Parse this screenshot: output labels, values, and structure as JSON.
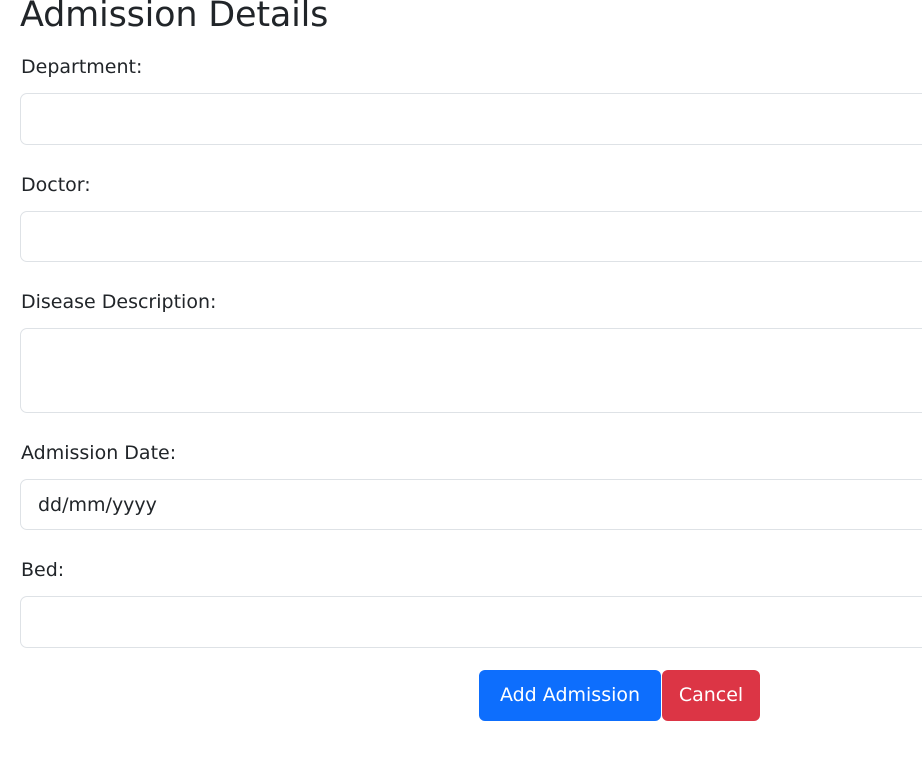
{
  "page": {
    "title": "Admission Details"
  },
  "form": {
    "department": {
      "label": "Department:",
      "value": "",
      "placeholder": ""
    },
    "doctor": {
      "label": "Doctor:",
      "value": "",
      "placeholder": ""
    },
    "disease_description": {
      "label": "Disease Description:",
      "value": "",
      "placeholder": ""
    },
    "admission_date": {
      "label": "Admission Date:",
      "value": "",
      "placeholder": "dd/mm/yyyy"
    },
    "bed": {
      "label": "Bed:",
      "value": "",
      "placeholder": ""
    }
  },
  "actions": {
    "add_label": "Add Admission",
    "cancel_label": "Cancel"
  },
  "colors": {
    "primary": "#0d6efd",
    "danger": "#dc3545",
    "input_border": "#dee2e6",
    "text": "#212529"
  }
}
